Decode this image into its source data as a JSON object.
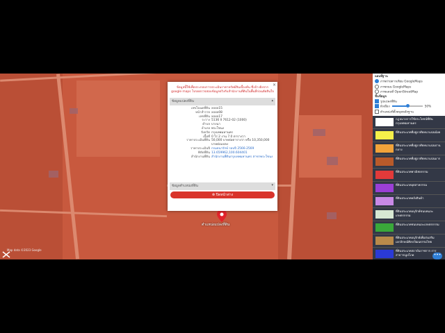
{
  "popup": {
    "notice": "ข้อมูลนี้ใช้เพื่อประกอบการประเมินราคาทรัพย์สินเบื้องต้น ซึ่งอ้างอิงจาก google maps โปรดตรวจสอบข้อมูลจริงกับสำนักงานที่ดินในพื้นที่ก่อนตัดสินใจ",
    "section_title": "ข้อมูลแปลงที่ดิน",
    "rows": [
      {
        "k": "เลขโฉนดที่ดิน",
        "v": "xxxx15"
      },
      {
        "k": "หน้าสำรวจ",
        "v": "xxxx08"
      },
      {
        "k": "เลขที่ดิน",
        "v": "xxxx17"
      },
      {
        "k": "ระวาง",
        "v": "5136 II 7612-02 (1000)"
      },
      {
        "k": "ตำบล",
        "v": "บางนา"
      },
      {
        "k": "อำเภอ",
        "v": "พระโขนง"
      },
      {
        "k": "จังหวัด",
        "v": "กรุงเทพมหานคร"
      },
      {
        "k": "เนื้อที่",
        "v": "0 ไร่ 2 งาน 7.0 ตารางวา"
      },
      {
        "k": "ราคาประเมินที่ดิน",
        "v": "50,000 บาทต่อตารางวา หรือ 10,350,000 บาทต่อแปลง"
      },
      {
        "k": "ราคาประเมินปี",
        "v": "กรมธนารักษ์ รอบปี 2566-2569"
      },
      {
        "k": "พิกัดที่ดิน",
        "v": "13.659962,100.604401"
      },
      {
        "k": "สำนักงานที่ดิน",
        "v": "สำนักงานที่ดินกรุงเทพมหานคร สาขาพระโขนง"
      }
    ],
    "section2_title": "ข้อมูลตำแหน่งที่ดิน",
    "button_label": "⊗ ปิดหน้าต่าง",
    "close": "×"
  },
  "map": {
    "pin_label": "ตำแหน่งแปลงที่ดิน",
    "attribution": "Map data ©2023 Google"
  },
  "panel": {
    "basemap_title": "แผนที่ฐาน",
    "basemaps": [
      "ภาพถ่ายดาวเทียม GoogleMaps",
      "ภาพถนน GoogleMaps",
      "ภาพแผนที่ OpenStreetMap"
    ],
    "layer_title": "ชั้นข้อมูล",
    "layers": [
      "รูปแปลงที่ดิน",
      "ผังเมือง",
      "ตำแหน่งที่ตั้งหมุดหลักฐาน"
    ],
    "opacity": "50%",
    "opacity_value": 0.5,
    "legend": [
      {
        "label": "กฎหมายการใช้ประโยชน์ที่ดิน กรุงเทพมหานคร",
        "color": "#ffffff"
      },
      {
        "label": "ที่ดินประเภทที่อยู่อาศัยหนาแน่นน้อย",
        "color": "#f5f04a"
      },
      {
        "label": "ที่ดินประเภทที่อยู่อาศัยหนาแน่นปานกลาง",
        "color": "#f2a33a"
      },
      {
        "label": "ที่ดินประเภทที่อยู่อาศัยหนาแน่นมาก",
        "color": "#b85a2a"
      },
      {
        "label": "ที่ดินประเภทพาณิชยกรรม",
        "color": "#e23a3a"
      },
      {
        "label": "ที่ดินประเภทอุตสาหกรรม",
        "color": "#9b3fd6"
      },
      {
        "label": "ที่ดินประเภทคลังสินค้า",
        "color": "#c989e6"
      },
      {
        "label": "ที่ดินประเภทอนุรักษ์ชนบทและเกษตรกรรม",
        "color": "#d7e8d3"
      },
      {
        "label": "ที่ดินประเภทชนบทและเกษตรกรรม",
        "color": "#3aa83a"
      },
      {
        "label": "ที่ดินประเภทอนุรักษ์เพื่อส่งเสริมเอกลักษณ์ศิลปวัฒนธรรมไทย",
        "color": "#b98a4a"
      },
      {
        "label": "ที่ดินประเภทสถาบันราชการ การสาธารณูปโภค",
        "color": "#2a3ad6"
      }
    ],
    "more": "•••"
  }
}
